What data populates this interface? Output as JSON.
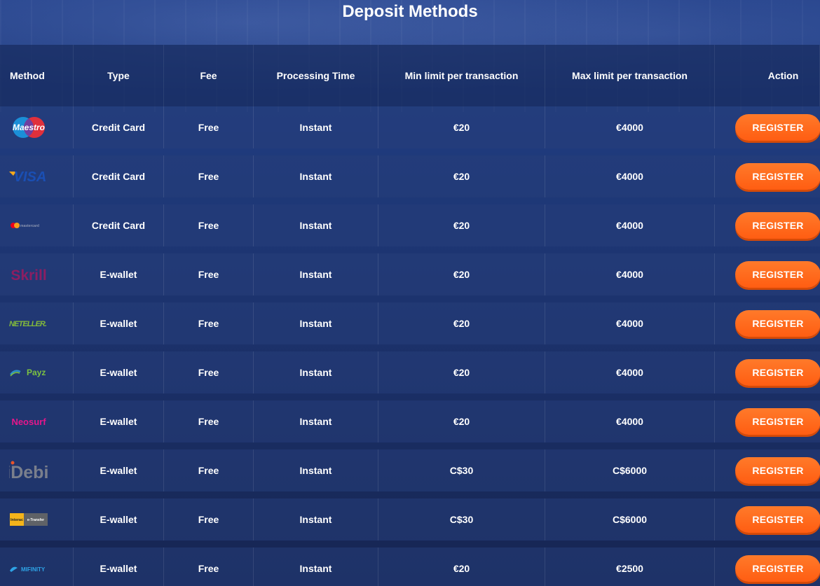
{
  "page_title": "Deposit Methods",
  "headers": {
    "method": "Method",
    "type": "Type",
    "fee": "Fee",
    "processing": "Processing Time",
    "min": "Min limit per transaction",
    "max": "Max limit per transaction",
    "action": "Action"
  },
  "rows": [
    {
      "method": "Maestro",
      "logo": "maestro-logo",
      "type": "Credit Card",
      "fee": "Free",
      "processing": "Instant",
      "min": "€20",
      "max": "€4000",
      "action": "REGISTER"
    },
    {
      "method": "VISA",
      "logo": "visa-logo",
      "type": "Credit Card",
      "fee": "Free",
      "processing": "Instant",
      "min": "€20",
      "max": "€4000",
      "action": "REGISTER"
    },
    {
      "method": "mastercard",
      "logo": "mastercard-logo",
      "type": "Credit Card",
      "fee": "Free",
      "processing": "Instant",
      "min": "€20",
      "max": "€4000",
      "action": "REGISTER"
    },
    {
      "method": "Skrill",
      "logo": "skrill-logo",
      "type": "E-wallet",
      "fee": "Free",
      "processing": "Instant",
      "min": "€20",
      "max": "€4000",
      "action": "REGISTER"
    },
    {
      "method": "NETELLER",
      "logo": "neteller-logo",
      "type": "E-wallet",
      "fee": "Free",
      "processing": "Instant",
      "min": "€20",
      "max": "€4000",
      "action": "REGISTER"
    },
    {
      "method": "Payz",
      "logo": "payz-logo",
      "type": "E-wallet",
      "fee": "Free",
      "processing": "Instant",
      "min": "€20",
      "max": "€4000",
      "action": "REGISTER"
    },
    {
      "method": "Neosurf",
      "logo": "neosurf-logo",
      "type": "E-wallet",
      "fee": "Free",
      "processing": "Instant",
      "min": "€20",
      "max": "€4000",
      "action": "REGISTER"
    },
    {
      "method": "iDebit",
      "logo": "idebit-logo",
      "type": "E-wallet",
      "fee": "Free",
      "processing": "Instant",
      "min": "C$30",
      "max": "C$6000",
      "action": "REGISTER"
    },
    {
      "method": "Interac e-Transfer",
      "logo": "interac-logo",
      "type": "E-wallet",
      "fee": "Free",
      "processing": "Instant",
      "min": "C$30",
      "max": "C$6000",
      "action": "REGISTER"
    },
    {
      "method": "MIFINITY",
      "logo": "mifinity-logo",
      "type": "E-wallet",
      "fee": "Free",
      "processing": "Instant",
      "min": "€20",
      "max": "€2500",
      "action": "REGISTER"
    }
  ],
  "colors": {
    "accent": "#ff6a1a",
    "background": "#1f3a7c"
  }
}
